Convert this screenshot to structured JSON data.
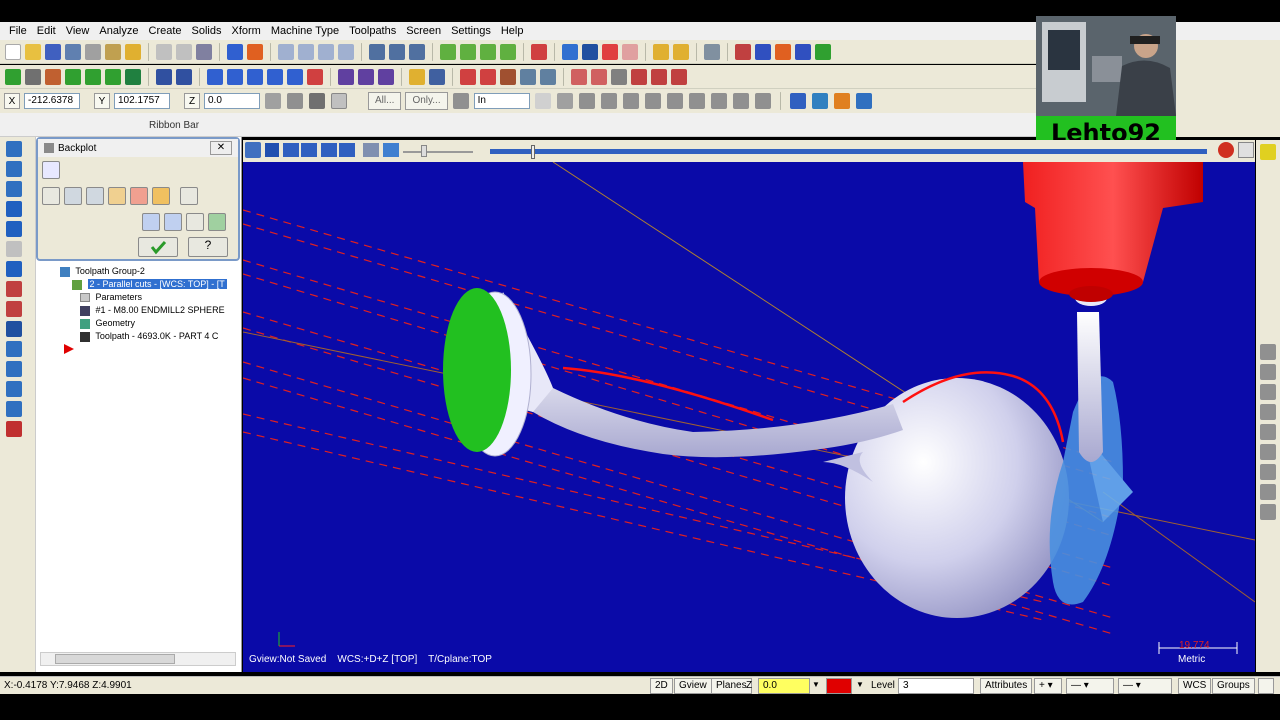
{
  "menu": [
    "File",
    "Edit",
    "View",
    "Analyze",
    "Create",
    "Solids",
    "Xform",
    "Machine Type",
    "Toolpaths",
    "Screen",
    "Settings",
    "Help"
  ],
  "coords": {
    "x_label": "X",
    "x_value": "-212.6378",
    "y_label": "Y",
    "y_value": "102.1757",
    "z_label": "Z",
    "z_value": "0.0",
    "all_btn": "All...",
    "only_btn": "Only...",
    "unit_value": "In"
  },
  "ribbon": {
    "label": "Ribbon Bar"
  },
  "webcam": {
    "name": "Lehto92"
  },
  "backplot": {
    "title": "Backplot"
  },
  "tree": {
    "group": "Toolpath Group-2",
    "operation": "2 - Parallel cuts - [WCS: TOP] - [T",
    "parameters": "Parameters",
    "tool": "#1 - M8.00 ENDMILL2 SPHERE",
    "geometry": "Geometry",
    "toolpath": "Toolpath - 4693.0K - PART 4 C"
  },
  "viewport": {
    "gview": "Gview:Not Saved",
    "wcs": "WCS:+D+Z [TOP]",
    "tcplane": "T/Cplane:TOP",
    "scale_value": "19.774",
    "scale_unit": "Metric"
  },
  "status": {
    "cursor": "X:-0.4178   Y:7.9468   Z:4.9901",
    "mode_2d": "2D",
    "gview_btn": "Gview",
    "planes_btn": "Planes",
    "z_label": "Z",
    "z_value": "0.0",
    "level_label": "Level",
    "level_value": "3",
    "attributes": "Attributes",
    "wcs_btn": "WCS",
    "groups_btn": "Groups"
  },
  "colors": {
    "viewport_bg": "#0a0aa8",
    "tool_red": "#e01010",
    "part_face": "#22c020",
    "webcam_label": "#22c020"
  }
}
